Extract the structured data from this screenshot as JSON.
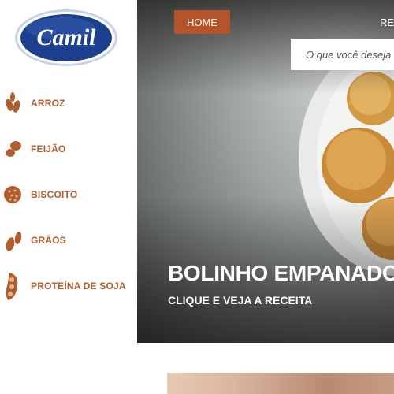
{
  "brand": {
    "logo_text": "Camil"
  },
  "sidebar": {
    "items": [
      {
        "label": "ARROZ",
        "icon": "rice-grains-icon"
      },
      {
        "label": "FEIJÃO",
        "icon": "bean-icon"
      },
      {
        "label": "BISCOITO",
        "icon": "cookie-icon"
      },
      {
        "label": "GRÃOS",
        "icon": "grains-icon"
      },
      {
        "label": "PROTEÍNA DE SOJA",
        "icon": "soy-pod-icon"
      }
    ]
  },
  "header": {
    "menu": [
      {
        "label": "HOME",
        "active": true
      },
      {
        "label": "REC"
      }
    ],
    "search_placeholder": "O que você deseja"
  },
  "hero": {
    "title": "BOLINHO EMPANADO",
    "cta": "CLIQUE E VEJA A RECEITA"
  },
  "colors": {
    "accent": "#b5532a",
    "nav_text": "#b15e2e",
    "logo_blue": "#1d3f8f"
  }
}
